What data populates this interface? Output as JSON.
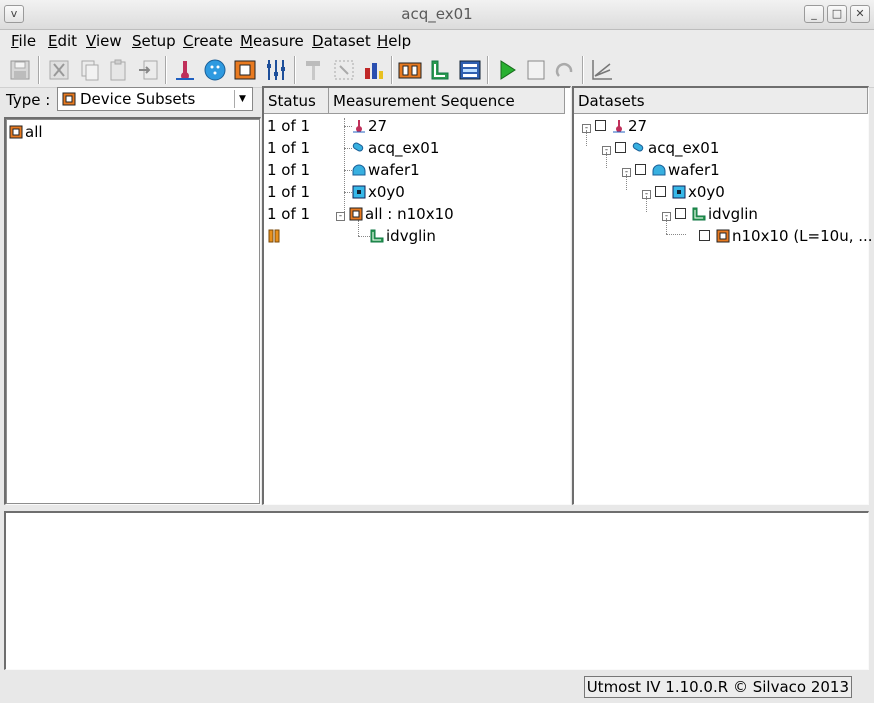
{
  "window": {
    "title": "acq_ex01",
    "menu_btn": "v",
    "min_btn": "_",
    "max_btn": "□",
    "close_btn": "✕"
  },
  "menu": [
    {
      "u": "F",
      "rest": "ile"
    },
    {
      "u": "E",
      "rest": "dit"
    },
    {
      "u": "V",
      "rest": "iew"
    },
    {
      "u": "S",
      "rest": "etup"
    },
    {
      "u": "C",
      "rest": "reate"
    },
    {
      "u": "M",
      "rest": "easure"
    },
    {
      "u": "D",
      "rest": "ataset"
    },
    {
      "u": "H",
      "rest": "elp"
    }
  ],
  "toolbar_icons": [
    "save-icon",
    "cut-icon",
    "copy-icon",
    "paste-icon",
    "import-icon",
    "temperature-icon",
    "wafer-icon",
    "device-icon",
    "sliders-icon",
    "hammer-icon",
    "select-icon",
    "chart-icon",
    "device-set-icon",
    "routine-icon",
    "export-icon",
    "run-icon",
    "stop-icon",
    "loop-icon",
    "plot-icon"
  ],
  "left_panel": {
    "type_label": "Type :",
    "type_value": "Device Subsets",
    "items": [
      "all"
    ]
  },
  "sequence": {
    "status_header": "Status",
    "sequence_header": "Measurement Sequence",
    "rows": [
      {
        "status": "1 of 1",
        "label": "27",
        "icon": "temperature-icon"
      },
      {
        "status": "1 of 1",
        "label": "acq_ex01",
        "icon": "project-icon"
      },
      {
        "status": "1 of 1",
        "label": "wafer1",
        "icon": "wafer-icon"
      },
      {
        "status": "1 of 1",
        "label": "x0y0",
        "icon": "die-icon"
      },
      {
        "status": "1 of 1",
        "label": "all : n10x10",
        "icon": "device-icon"
      },
      {
        "status": "",
        "label": "idvglin",
        "icon": "routine-icon"
      }
    ]
  },
  "datasets": {
    "header": "Datasets",
    "rows": [
      {
        "label": "27",
        "icon": "temperature-icon"
      },
      {
        "label": "acq_ex01",
        "icon": "project-icon"
      },
      {
        "label": "wafer1",
        "icon": "wafer-icon"
      },
      {
        "label": "x0y0",
        "icon": "die-icon"
      },
      {
        "label": "idvglin",
        "icon": "routine-icon"
      },
      {
        "label": "n10x10 (L=10u, ...",
        "icon": "device-icon"
      }
    ]
  },
  "statusbar": {
    "text": "Utmost IV 1.10.0.R © Silvaco 2013"
  }
}
